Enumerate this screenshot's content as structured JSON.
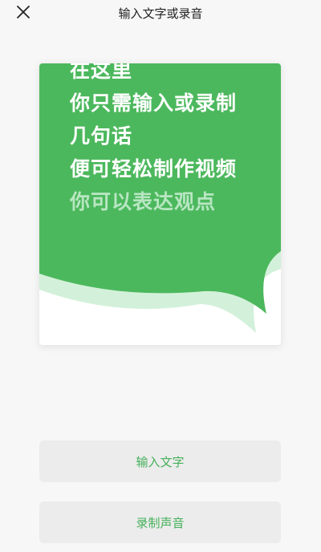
{
  "header": {
    "title": "输入文字或录音",
    "close_icon": "close-icon"
  },
  "card": {
    "lines": [
      "在这里",
      "你只需输入或录制",
      "几句话",
      "便可轻松制作视频",
      "你可以表达观点"
    ],
    "colors": {
      "bubble": "#4cb85d",
      "bubble_shadow": "#d3f1da",
      "background": "#ffffff"
    }
  },
  "actions": {
    "input_text_label": "输入文字",
    "record_audio_label": "录制声音"
  },
  "colors": {
    "accent": "#45b05a",
    "page_bg": "#f7f7f7",
    "button_bg": "#ececec"
  }
}
